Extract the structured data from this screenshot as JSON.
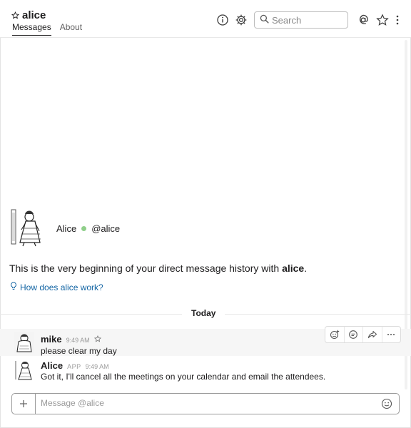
{
  "header": {
    "channel_name": "alice",
    "tabs": [
      {
        "label": "Messages",
        "active": true
      },
      {
        "label": "About",
        "active": false
      }
    ],
    "search_placeholder": "Search",
    "icons": [
      "info-icon",
      "gear-icon",
      "search-icon",
      "at-icon",
      "star-icon",
      "more-vertical-icon"
    ]
  },
  "intro": {
    "name": "Alice",
    "handle": "@alice",
    "presence_color": "#8fcf8a",
    "text_prefix": "This is the very beginning of your direct message history with ",
    "text_name": "alice",
    "text_suffix": ".",
    "help_link": "How does alice work?"
  },
  "divider": {
    "label": "Today"
  },
  "messages": [
    {
      "sender": "mike",
      "badge": "",
      "time": "9:49 AM",
      "text": "please clear my day",
      "hovered": true
    },
    {
      "sender": "Alice",
      "badge": "APP",
      "time": "9:49 AM",
      "text": "Got it, I'll cancel all the meetings on your calendar and email the attendees.",
      "hovered": false
    }
  ],
  "message_actions": [
    "add-reaction-icon",
    "reply-thread-icon",
    "share-icon",
    "more-actions-icon"
  ],
  "composer": {
    "placeholder": "Message @alice"
  },
  "colors": {
    "link": "#1264a3",
    "text": "#1d1c1d",
    "muted": "#616061"
  }
}
